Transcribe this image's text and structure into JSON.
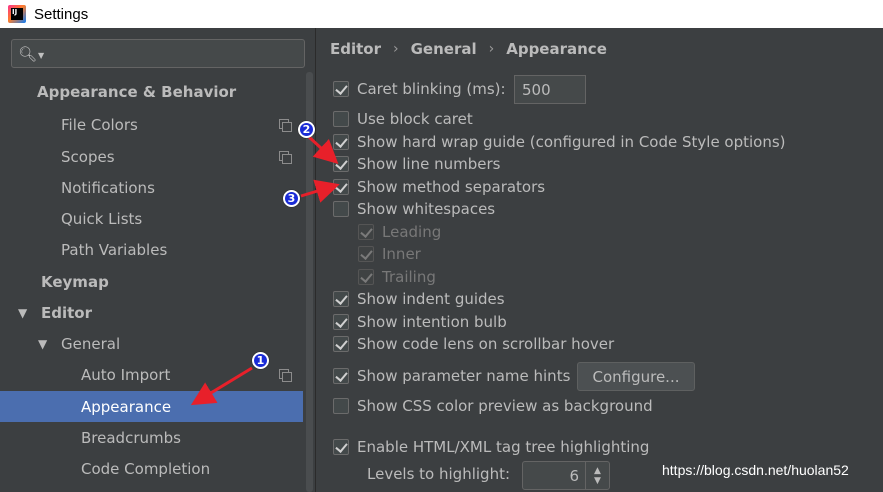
{
  "window": {
    "title": "Settings",
    "app_icon": "intellij-idea-icon",
    "app_icon_text": "IJ"
  },
  "search": {
    "placeholder": "",
    "icon": "search-icon"
  },
  "sidebar": {
    "items": [
      {
        "label": "Appearance & Behavior",
        "bold": true
      },
      {
        "label": "File Colors",
        "copy_icon": true
      },
      {
        "label": "Scopes",
        "copy_icon": true
      },
      {
        "label": "Notifications"
      },
      {
        "label": "Quick Lists"
      },
      {
        "label": "Path Variables"
      },
      {
        "label": "Keymap",
        "bold": true
      },
      {
        "label": "Editor",
        "bold": true,
        "expanded": true
      },
      {
        "label": "General",
        "expanded": true
      },
      {
        "label": "Auto Import",
        "copy_icon": true
      },
      {
        "label": "Appearance",
        "selected": true
      },
      {
        "label": "Breadcrumbs"
      },
      {
        "label": "Code Completion"
      }
    ],
    "expand_glyph": "▼"
  },
  "breadcrumb": [
    "Editor",
    "General",
    "Appearance"
  ],
  "breadcrumb_sep": "›",
  "options": {
    "caret_blinking": {
      "label": "Caret blinking (ms):",
      "checked": true,
      "value": "500"
    },
    "use_block_caret": {
      "label": "Use block caret",
      "checked": false
    },
    "show_hard_wrap": {
      "label": "Show hard wrap guide (configured in Code Style options)",
      "checked": true
    },
    "show_line_numbers": {
      "label": "Show line numbers",
      "checked": true
    },
    "show_method_separators": {
      "label": "Show method separators",
      "checked": true
    },
    "show_whitespaces": {
      "label": "Show whitespaces",
      "checked": false
    },
    "leading": {
      "label": "Leading",
      "checked": true,
      "disabled": true
    },
    "inner": {
      "label": "Inner",
      "checked": true,
      "disabled": true
    },
    "trailing": {
      "label": "Trailing",
      "checked": true,
      "disabled": true
    },
    "show_indent_guides": {
      "label": "Show indent guides",
      "checked": true
    },
    "show_intention_bulb": {
      "label": "Show intention bulb",
      "checked": true
    },
    "show_code_lens": {
      "label": "Show code lens on scrollbar hover",
      "checked": true
    },
    "show_param_hints": {
      "label": "Show parameter name hints",
      "checked": true
    },
    "configure_button": "Configure...",
    "show_css_color": {
      "label": "Show CSS color preview as background",
      "checked": false
    },
    "enable_html_xml": {
      "label": "Enable HTML/XML tag tree highlighting",
      "checked": true
    },
    "levels_label": "Levels to highlight:",
    "levels_value": "6"
  },
  "annotations": {
    "badge1": "1",
    "badge2": "2",
    "badge3": "3",
    "arrow_color": "#e8202a",
    "badge_color": "#1a2bd6"
  },
  "watermark": "https://blog.csdn.net/huolan52",
  "colors": {
    "background": "#3c3f41",
    "selection": "#4b6eaf",
    "text": "#bbbbbb"
  }
}
